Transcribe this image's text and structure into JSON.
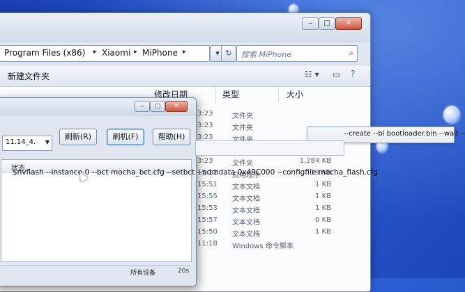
{
  "explorer": {
    "breadcrumb": [
      "Program Files (x86)",
      "Xiaomi",
      "MiPhone"
    ],
    "breadcrumb_sep": "▸",
    "search_placeholder": "搜索 MiPhone",
    "toolbar_new_folder": "新建文件夹",
    "headers": {
      "modified": "修改日期",
      "type": "类型",
      "size": "大小"
    },
    "rows": [
      {
        "time": "3:23",
        "type": "文件夹",
        "size": ""
      },
      {
        "time": "3:23",
        "type": "文件夹",
        "size": ""
      },
      {
        "time": "3:23",
        "type": "文件夹",
        "size": ""
      },
      {
        "time": "3:23",
        "type": "文件夹",
        "size": ""
      },
      {
        "time": "3:23",
        "type": "文件夹",
        "size": "1,284 KB"
      },
      {
        "time": "15:12",
        "type": "应用程序",
        "size": "19 KB"
      },
      {
        "time": "15:51",
        "type": "文本文档",
        "size": "1 KB"
      },
      {
        "time": "15:55",
        "type": "文本文档",
        "size": "1 KB"
      },
      {
        "time": "15:53",
        "type": "文本文档",
        "size": "1 KB"
      },
      {
        "time": "15:57",
        "type": "文本文档",
        "size": "0 KB"
      },
      {
        "time": "15:50",
        "type": "文本文档",
        "size": "1 KB"
      },
      {
        "time": "11:18",
        "type": "Windows 命令脚本",
        "size": ""
      }
    ]
  },
  "dialog": {
    "device_combo": "11.14_4.",
    "buttons": {
      "refresh": "刷新(R)",
      "flash": "刷机(F)",
      "help": "帮助(H)"
    },
    "status_header": "状态",
    "command_start": "$nvflash --instance 0 --bct mocha_bct.cfg --setbct --odmdata 0x49C000 --configfile mocha_flash.cfg",
    "command_end": "--create --bl bootloader.bin --wait --go",
    "footer_left": "所有设备",
    "footer_right": "20s"
  }
}
